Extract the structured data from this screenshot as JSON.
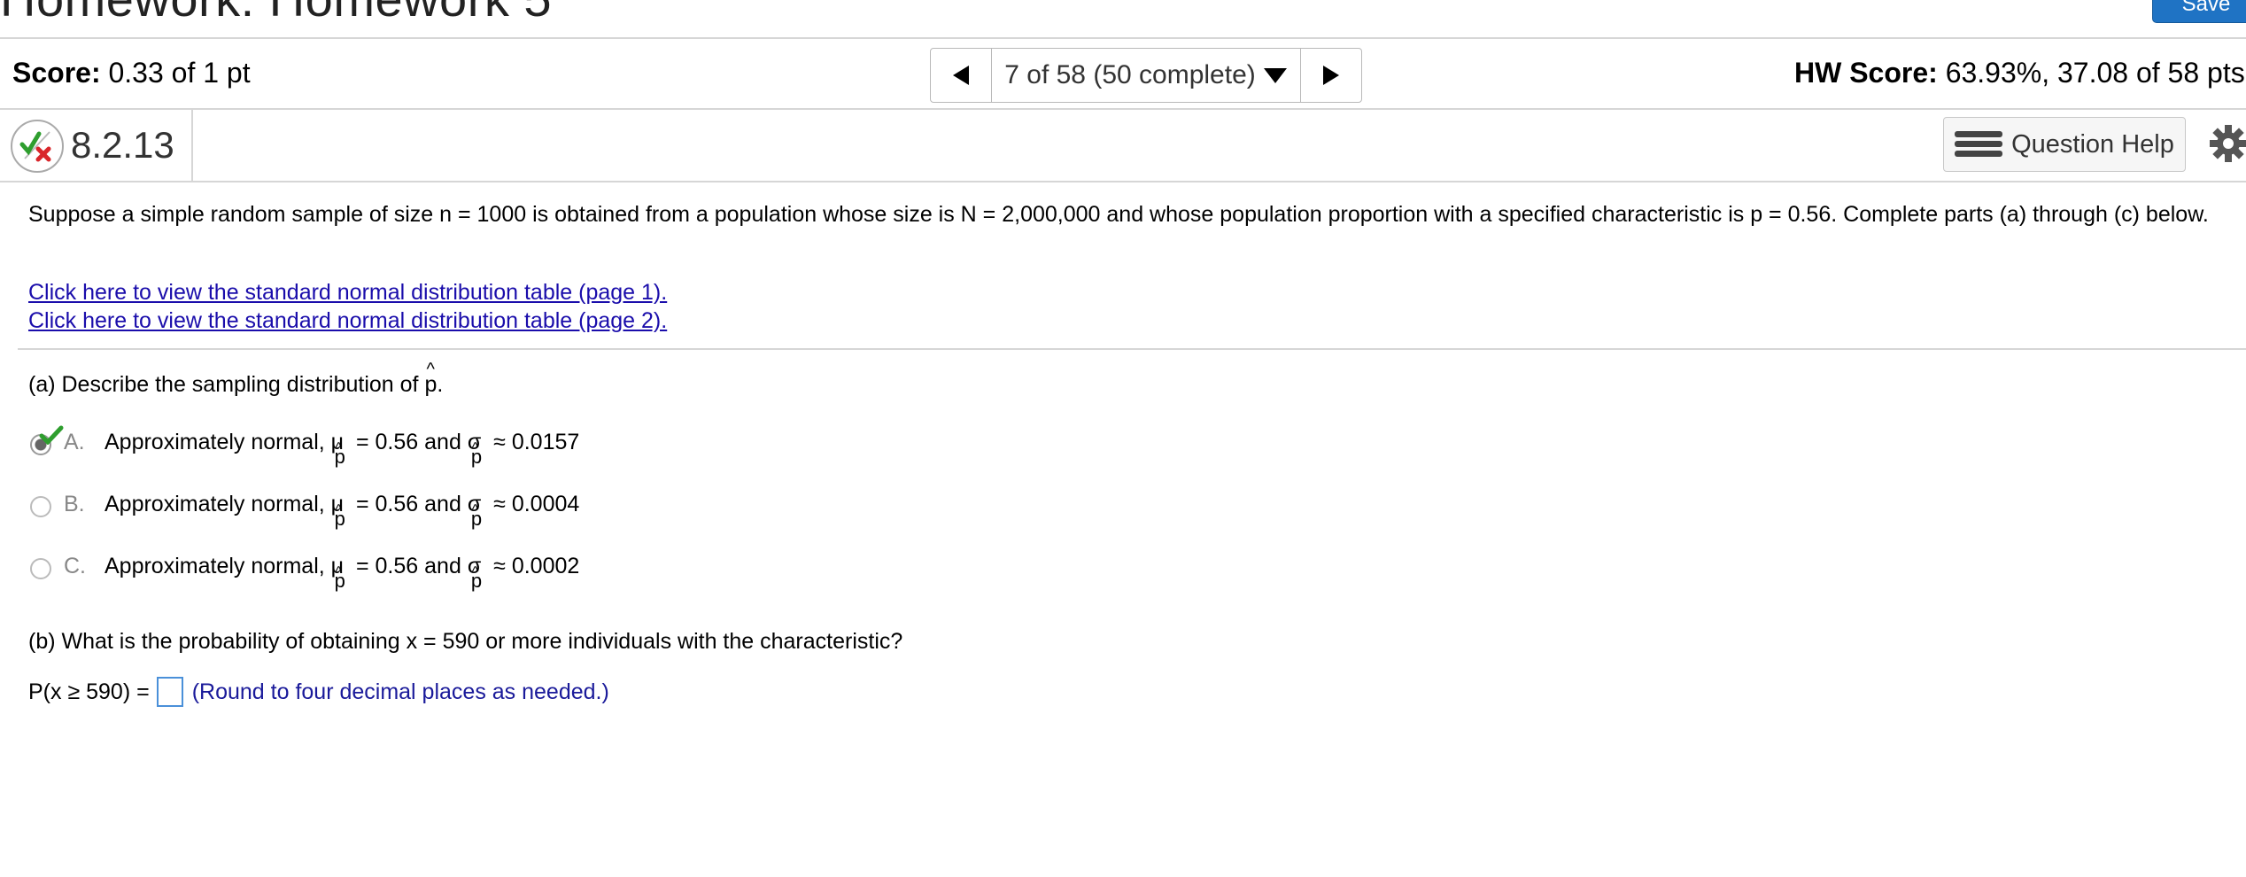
{
  "header": {
    "title": "Homework: Homework 5",
    "save_label": "Save"
  },
  "score_bar": {
    "score_label": "Score:",
    "score_value": "0.33 of 1 pt",
    "nav_text": "7 of 58 (50 complete)",
    "hw_score_label": "HW Score:",
    "hw_score_value": "63.93%, 37.08 of 58 pts"
  },
  "question": {
    "number": "8.2.13",
    "help_label": "Question Help",
    "prompt": "Suppose a simple random sample of size n = 1000 is obtained from a population whose size is N = 2,000,000 and whose population proportion with a specified characteristic is p = 0.56. Complete parts (a) through (c) below.",
    "link1": "Click here to view the standard normal distribution table (page 1).",
    "link2": "Click here to view the standard normal distribution table (page 2).",
    "part_a": {
      "text": "(a) Describe the sampling distribution of",
      "var": "p",
      "choices": [
        {
          "letter": "A.",
          "prefix": "Approximately normal,",
          "mu": "= 0.56",
          "and": "and",
          "sigma": "≈ 0.0157",
          "selected": true
        },
        {
          "letter": "B.",
          "prefix": "Approximately normal,",
          "mu": "= 0.56",
          "and": "and",
          "sigma": "≈ 0.0004",
          "selected": false
        },
        {
          "letter": "C.",
          "prefix": "Approximately normal,",
          "mu": "= 0.56",
          "and": "and",
          "sigma": "≈ 0.0002",
          "selected": false
        }
      ]
    },
    "part_b": {
      "text": "(b) What is the probability of obtaining x = 590 or more individuals with the characteristic?",
      "answer_prefix": "P(x ≥ 590) =",
      "answer_value": "",
      "note": "(Round to four decimal places as needed.)"
    }
  },
  "colors": {
    "accent": "#1f73c4",
    "link": "#1a0dab",
    "correct": "#2e9e2e",
    "incorrect": "#d9262b"
  }
}
